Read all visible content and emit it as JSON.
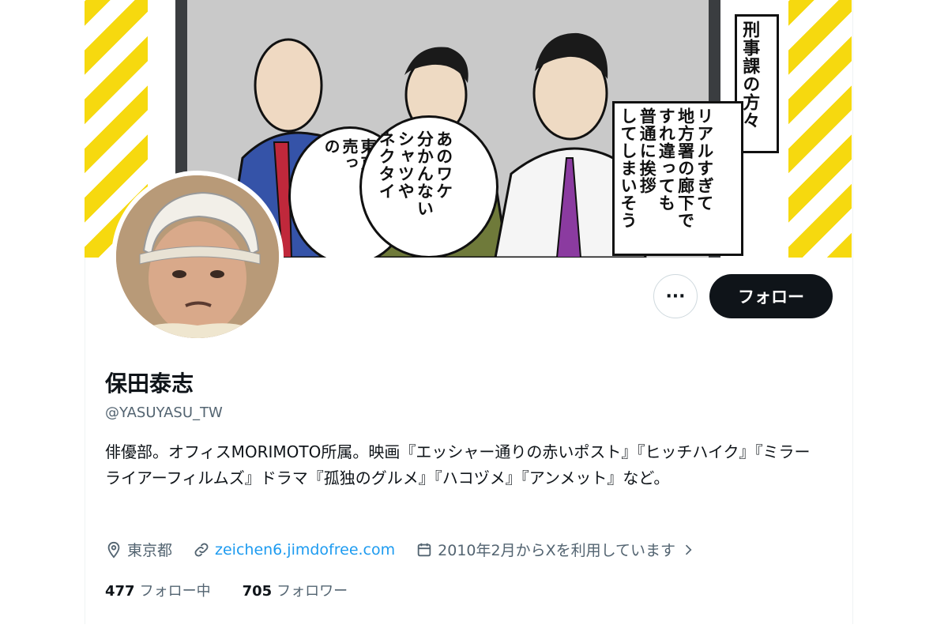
{
  "profile": {
    "name": "保田泰志",
    "handle": "@YASUYASU_TW",
    "bio": "俳優部。オフィスMORIMOTO所属。映画『エッシャー通りの赤いポスト』『ヒッチハイク』『ミラーライアーフィルムズ』ドラマ『孤独のグルメ』『ハコヅメ』『アンメット』など。",
    "location": "東京都",
    "website": "zeichen6.jimdofree.com",
    "joined": "2010年2月からXを利用しています",
    "following_count": "477",
    "following_label": "フォロー中",
    "followers_count": "705",
    "followers_label": "フォロワー"
  },
  "actions": {
    "more_label": "···",
    "follow_label": "フォロー"
  },
  "banner": {
    "caption_lines": [
      "刑事課の方々",
      "リアルすぎて",
      "地方署の廊下で",
      "すれ違っても",
      "普通に挨拶",
      "してしまいそう"
    ],
    "balloon1_lines": [
      "あのワケ",
      "分かんない",
      "シャツや",
      "ネクタイ"
    ],
    "balloon2_lines": [
      "東京で",
      "売っ",
      "の"
    ]
  },
  "colors": {
    "follow_bg": "#0f1419",
    "link": "#1d9bf0",
    "secondary_text": "#536471",
    "stripe_yellow": "#f6d90f"
  }
}
